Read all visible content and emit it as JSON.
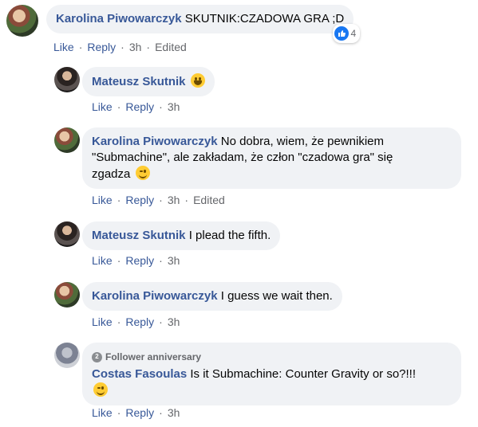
{
  "comments": [
    {
      "author": "Karolina Piwowarczyk",
      "text": "SKUTNIK:CZADOWA GRA ;D",
      "reaction_count": "4",
      "like": "Like",
      "reply": "Reply",
      "time": "3h",
      "edited": "Edited"
    },
    {
      "author": "Mateusz Skutnik",
      "text": "",
      "like": "Like",
      "reply": "Reply",
      "time": "3h"
    },
    {
      "author": "Karolina Piwowarczyk",
      "text_line1": "No dobra, wiem, że pewnikiem",
      "text_line2": "\"Submachine\", ale zakładam, że człon \"czadowa gra\" się",
      "text_line3": "zgadza",
      "like": "Like",
      "reply": "Reply",
      "time": "3h",
      "edited": "Edited"
    },
    {
      "author": "Mateusz Skutnik",
      "text": "I plead the fifth.",
      "like": "Like",
      "reply": "Reply",
      "time": "3h"
    },
    {
      "author": "Karolina Piwowarczyk",
      "text": "I guess we wait then.",
      "like": "Like",
      "reply": "Reply",
      "time": "3h"
    },
    {
      "badge": "Follower anniversary",
      "author": "Costas Fasoulas",
      "text": "Is it Submachine: Counter Gravity or so?!!!",
      "like": "Like",
      "reply": "Reply",
      "time": "3h"
    }
  ],
  "colors": {
    "link": "#385898",
    "bubble": "#f0f2f5",
    "meta": "#65676b",
    "like_blue": "#1877f2"
  },
  "icons": [
    "like-reaction-icon",
    "grinning-emoji-icon",
    "wink-emoji-icon",
    "follower-badge-icon"
  ]
}
